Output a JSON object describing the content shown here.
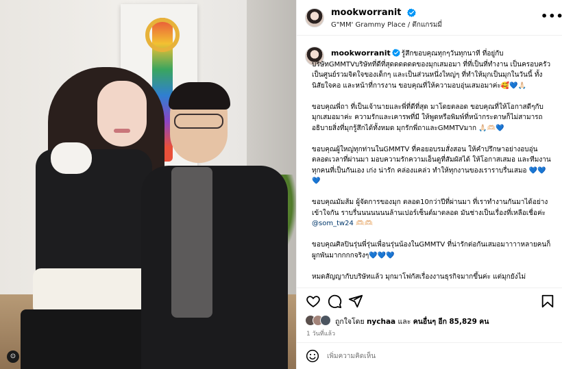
{
  "post": {
    "username": "mookworranit",
    "location": "G\"MM' Grammy Place / ตึกแกรมมี่",
    "more_icon": "•••"
  },
  "caption": {
    "username": "mookworranit",
    "paragraphs": [
      "รู้สึกขอบคุณทุกๆวันทุกนาที ที่อยู่กับบริษัทGMMTVบริษัทที่ดีที่สุดดดดดดของมุกเสมอมา ที่ที่เป็นที่ทำงาน เป็นครอบครัว เป็นศูนย์รวมจิตใจของเด็กๆ และเป็นส่วนหนึ่งใหญ่ๆ ที่ทำให้มุกเป็นมุกในวันนี้ ทั้งนิสัยใจคอ และหน้าที่การงาน ขอบคุณที่ให้ความอบอุ่นเสมอมาค่ะ🥰💙🙏🏻",
      "ขอบคุณพี่ถา ที่เป็นเจ้านายและพี่ที่ดีที่สุด มาโดยตลอด ขอบคุณที่ให้โอกาสดีๆกับมุกเสมอมาค่ะ ความรักและเคารพที่มี ให้พูดหรือพิมพ์ที่หน้ากระดาษก็ไม่สามารถอธิบายสิ่งที่มุกรู้สึกได้ทั้งหมด มุกรักพี่ถาและGMMTVมาก 🙏🏻🫶🏻💙",
      "ขอบคุณผู้ใหญ่ทุกท่านในGMMTV ที่คอยอบรมสั่งสอน ให้คำปรึกษาอย่างอบอุ่นตลอดเวลาที่ผ่านมา มอบความรักความเอ็นดูที่สัมผัสได้ ให้โอกาสเสมอ และทีมงานทุกคนที่เป็นกันเอง เก่ง น่ารัก คล่องแคล่ว ทำให้ทุกงานของเราราบรื่นเสมอ 💙💙💙",
      "ขอบคุณมัมส้ม ผู้จัดการของมุก ตลอด10กว่าปีที่ผ่านมา ที่เราทำงานกันมาได้อย่างเข้าใจกัน ราบรื่นนนนนนนล้านเปอร์เซ็นต์มาตลอด มันช่างเป็นเรื่องที่เหลือเชื่อค่ะ",
      "ขอบคุณศิลปินรุ่นพี่รุ่นเพื่อนรุ่นน้องในGMMTV ที่น่ารักต่อกันเสมอมาาาาหลายคนก็ผูกพันมากกกกจริงๆ💙💙💙",
      "หมดสัญญากับบริษัทแล้ว มุกมาโฟกัสเรื่องงานธุรกิจมากขึ้นค่ะ แต่มุกยังไม่"
    ],
    "mention": "@som_tw24",
    "mention_suffix": "🫶🏻🫶🏻"
  },
  "likes": {
    "prefix": "ถูกใจโดย",
    "user": "nychaa",
    "middle": "และ",
    "others": "คนอื่นๆ",
    "count_prefix": "อีก",
    "count": "85,829",
    "suffix": "คน"
  },
  "time": "1 วันที่แล้ว",
  "add_comment": {
    "placeholder": "เพิ่มความคิดเห็น"
  },
  "photo": {
    "ig_logo": "⊙"
  },
  "colors": {
    "verified": "#0095f6",
    "mention": "#00376b",
    "muted": "#737373",
    "border": "#efefef"
  },
  "icons": [
    "more-icon",
    "verified-icon",
    "heart-icon",
    "comment-icon",
    "share-icon",
    "save-icon",
    "emoji-icon"
  ]
}
